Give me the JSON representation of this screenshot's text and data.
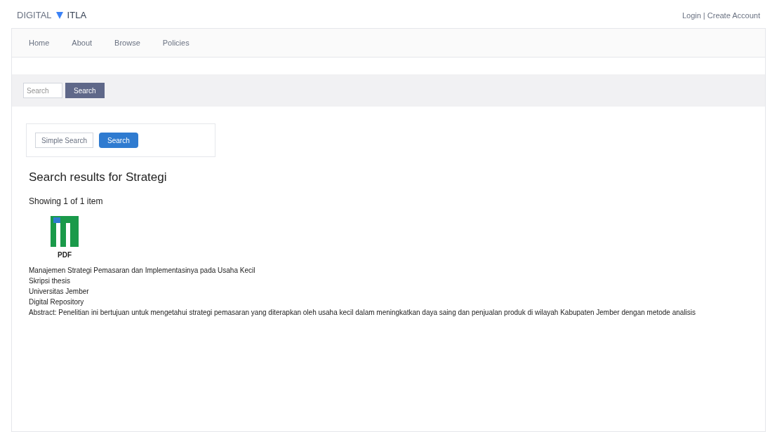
{
  "header": {
    "logo_text": "DIGITAL",
    "logo_suffix": "ITLA",
    "account_links": "Login | Create Account"
  },
  "menu": [
    {
      "label": "Home",
      "selected": false
    },
    {
      "label": "About",
      "selected": false
    },
    {
      "label": "Browse",
      "selected": false
    },
    {
      "label": "Policies",
      "selected": false
    }
  ],
  "search_bar": {
    "placeholder": "Search",
    "button": "Search"
  },
  "simple_search": {
    "select_value": "Simple Search",
    "button": "Search"
  },
  "heading": "Search results for Strategi",
  "summary": "Showing 1 of 1 item",
  "item": {
    "format": "PDF",
    "lines": [
      "Manajemen Strategi Pemasaran dan Implementasinya pada Usaha Kecil",
      "Skripsi thesis",
      "Universitas Jember",
      "Digital Repository",
      "Abstract: Penelitian ini bertujuan untuk mengetahui strategi pemasaran yang diterapkan oleh usaha kecil dalam meningkatkan daya saing dan penjualan produk di wilayah Kabupaten Jember dengan metode analisis"
    ]
  }
}
